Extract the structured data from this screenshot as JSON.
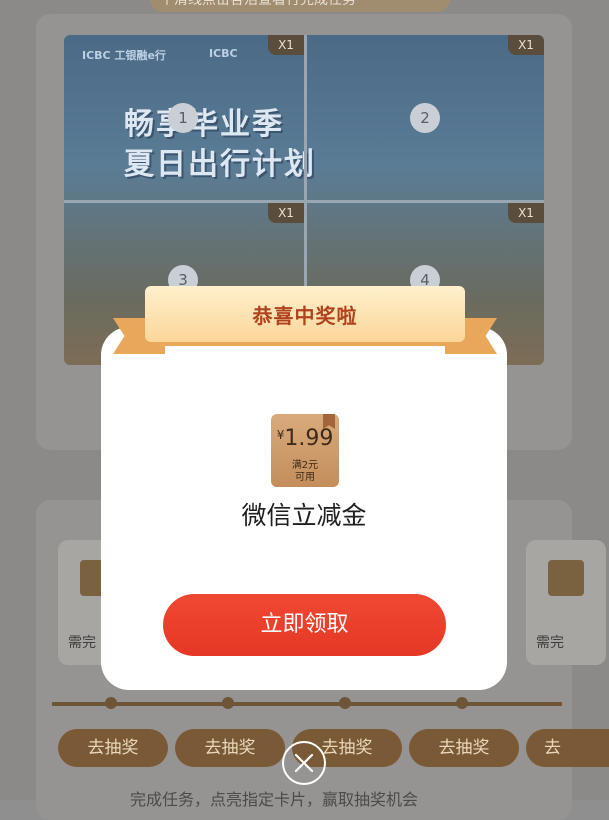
{
  "background": {
    "hint_text": "个清线点击各活查看行完成任务",
    "poster": {
      "brand_left": "ICBC 工银融e行",
      "brand_right": "ICBC",
      "title_line1": "畅享毕业季",
      "title_line2": "夏日出行计划"
    },
    "puzzle_pieces": [
      {
        "number": "1",
        "badge": "X1"
      },
      {
        "number": "2",
        "badge": "X1"
      },
      {
        "number": "3",
        "badge": "X1"
      },
      {
        "number": "4",
        "badge": "X1"
      }
    ],
    "task_cards": [
      {
        "label": "需完"
      },
      {
        "label": "需完"
      }
    ],
    "draw_buttons": [
      "去抽奖",
      "去抽奖",
      "去抽奖",
      "去抽奖",
      "去"
    ],
    "footer_tip": "完成任务，点亮指定卡片，赢取抽奖机会"
  },
  "modal": {
    "title": "恭喜中奖啦",
    "coupon": {
      "currency": "¥",
      "amount": "1.99",
      "condition_line1": "满2元",
      "condition_line2": "可用"
    },
    "prize_name": "微信立减金",
    "claim_label": "立即领取"
  },
  "colors": {
    "accent_red": "#e53725",
    "ribbon_gold": "#fbd69a",
    "ribbon_text": "#b0431e",
    "coupon_bronze": "#c48d5c"
  }
}
